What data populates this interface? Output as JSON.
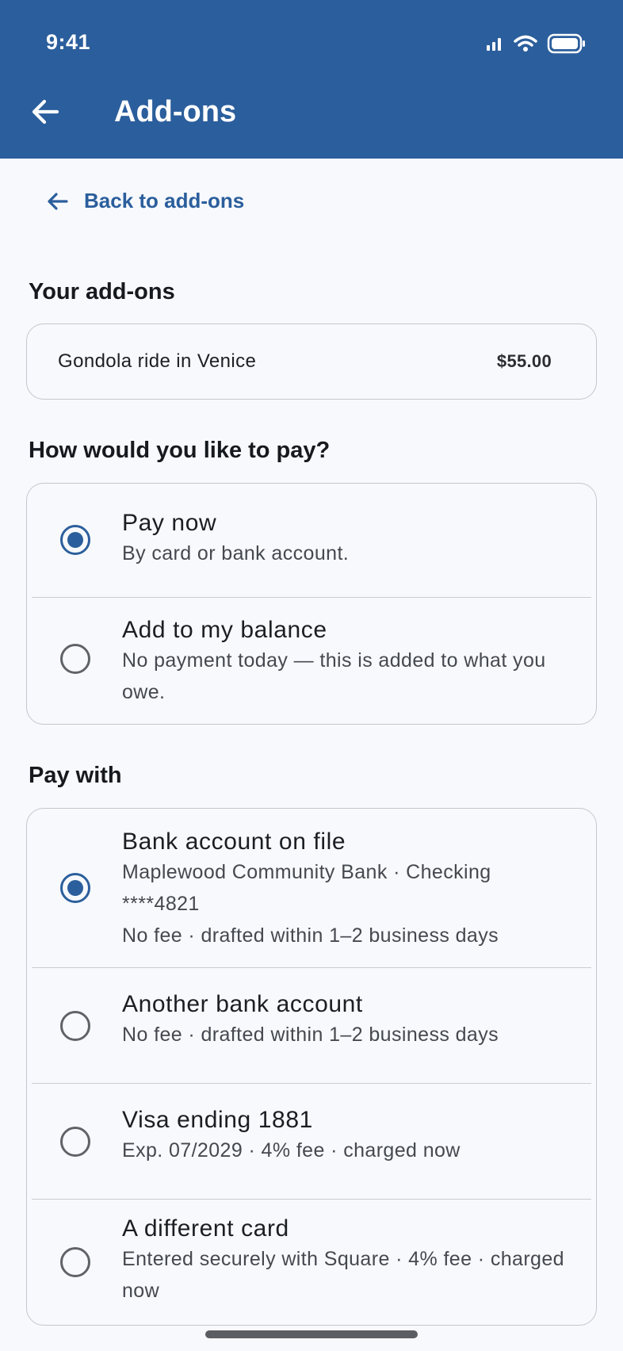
{
  "status_bar": {
    "time": "9:41"
  },
  "appbar": {
    "title": "Add-ons"
  },
  "back_link": {
    "label": "Back to add-ons"
  },
  "your_addons": {
    "heading": "Your add-ons",
    "items": [
      {
        "name": "Gondola ride in Venice",
        "price": "$55.00"
      }
    ]
  },
  "pay_choice": {
    "heading": "How would you like to pay?",
    "options": [
      {
        "title": "Pay now",
        "subtitle": "By card or bank account.",
        "selected": true
      },
      {
        "title": "Add to my balance",
        "subtitle": "No payment today — this is added to what you owe.",
        "selected": false
      }
    ]
  },
  "pay_with": {
    "heading": "Pay with",
    "options": [
      {
        "title": "Bank account on file",
        "line1": "Maplewood Community Bank · Checking ****4821",
        "line2": "No fee · drafted within 1–2 business days",
        "selected": true
      },
      {
        "title": "Another bank account",
        "line1": "No fee · drafted within 1–2 business days",
        "selected": false
      },
      {
        "title": "Visa ending 1881",
        "line1": "Exp. 07/2029 · 4% fee · charged now",
        "selected": false
      },
      {
        "title": "A different card",
        "line1": "Entered securely with Square · 4% fee · charged now",
        "selected": false
      }
    ]
  },
  "colors": {
    "brand": "#2b5e9c",
    "background": "#f7f9fc",
    "border": "#c3c7cd"
  },
  "icons": [
    "signal-icon",
    "wifi-icon",
    "battery-icon",
    "back-arrow-icon",
    "radio-icon"
  ]
}
